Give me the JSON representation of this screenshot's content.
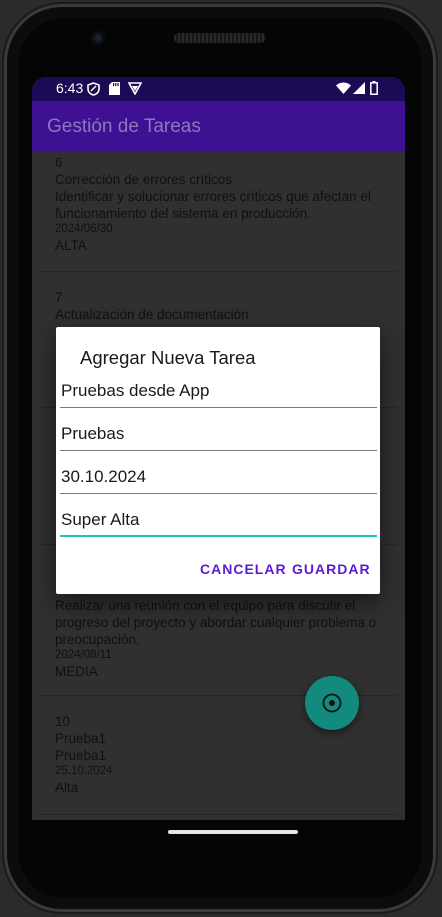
{
  "status_bar": {
    "time": "6:43",
    "icons": [
      "privacy-shield-icon",
      "sd-card-icon",
      "vpn-icon",
      "wifi-icon",
      "signal-icon",
      "battery-icon"
    ]
  },
  "app_bar": {
    "title": "Gestión de Tareas"
  },
  "tasks": [
    {
      "id": "6",
      "title": "Corrección de errores críticos",
      "description": "Identificar y solucionar errores críticos que afectan el funcionamiento del sistema en producción.",
      "date": "2024/06/30",
      "priority": "ALTA"
    },
    {
      "id": "7",
      "title": "Actualización de documentación",
      "description": "",
      "date": "",
      "priority": ""
    },
    {
      "id": "",
      "title": "",
      "description": "Realizar una reunión con el equipo para discutir el progreso del proyecto y abordar cualquier problema o preocupación.",
      "date": "2024/08/11",
      "priority": "MEDIA"
    },
    {
      "id": "10",
      "title": "Prueba1",
      "description": "Prueba1",
      "date": "25.10.2024",
      "priority": "Alta"
    }
  ],
  "dialog": {
    "title": "Agregar Nueva Tarea",
    "fields": {
      "title_value": "Pruebas desde App",
      "description_value": "Pruebas",
      "date_value": "30.10.2024",
      "priority_value": "Super Alta"
    },
    "cancel_label": "CANCELAR",
    "save_label": "GUARDAR"
  },
  "fab": {
    "icon": "add-task-icon"
  },
  "colors": {
    "status_bar": "#1c0a55",
    "app_bar": "#3d1192",
    "accent": "#5b1bd6",
    "fab": "#128a7d",
    "focus_line": "#18c7b4"
  }
}
